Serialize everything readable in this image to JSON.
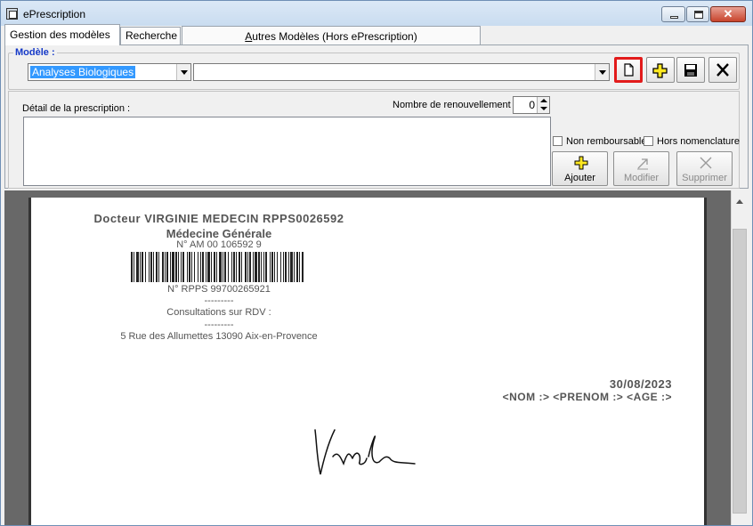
{
  "window": {
    "title": "ePrescription"
  },
  "tabs": [
    {
      "label": "Gestion des modèles"
    },
    {
      "label": "Recherche"
    },
    {
      "label_prefix": "A",
      "label_rest": "utres Modèles (Hors ePrescription)"
    }
  ],
  "modele": {
    "label": "Modèle :",
    "category_value": "Analyses Biologiques",
    "template_value": ""
  },
  "toolbar": {
    "new_icon": "new-document-icon",
    "add_icon": "plus-icon",
    "save_icon": "floppy-disk-icon",
    "delete_icon": "x-icon"
  },
  "detail": {
    "label": "Détail de la prescription :",
    "renewal_label": "Nombre de renouvellement :",
    "renewal_value": "0",
    "non_remboursable_label": "Non remboursable",
    "hors_nomenclature_label": "Hors nomenclature",
    "ajouter_label": "Ajouter",
    "modifier_label": "Modifier",
    "supprimer_label": "Supprimer"
  },
  "prescription_preview": {
    "doctor": "Docteur VIRGINIE MEDECIN RPPS0026592",
    "specialty": "Médecine Générale",
    "am_number": "N° AM 00 106592 9",
    "rpps_number": "N° RPPS 99700265921",
    "separator1": "---------",
    "consultation": "Consultations sur RDV :",
    "separator2": "---------",
    "address": "5 Rue des Allumettes 13090 Aix-en-Provence",
    "date": "30/08/2023",
    "patient_placeholder": "<NOM :> <PRENOM :> <AGE :>",
    "signature_text": "Vredu"
  },
  "colors": {
    "highlight_border": "#e21b1b",
    "group_label": "#1539c8",
    "selection": "#3399ff"
  }
}
